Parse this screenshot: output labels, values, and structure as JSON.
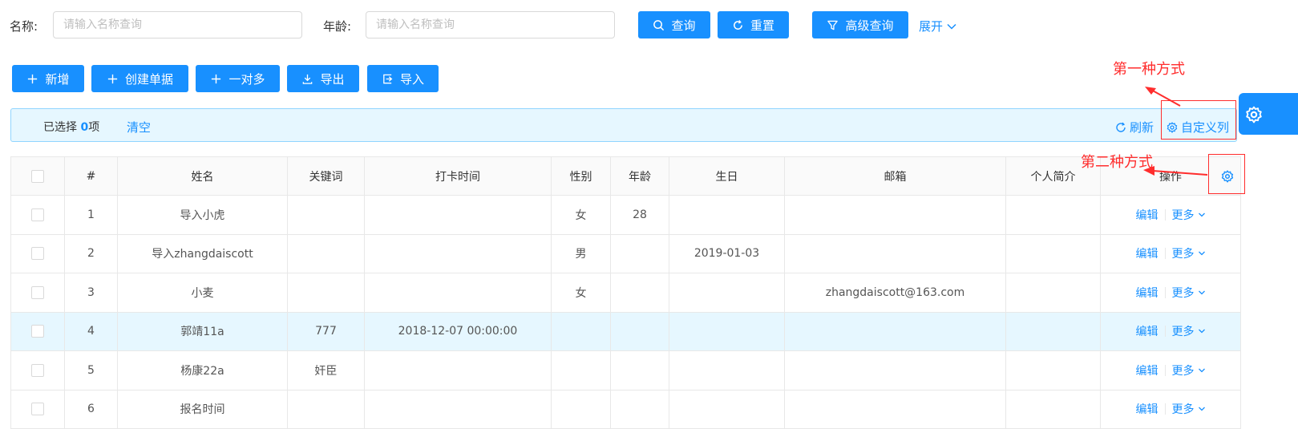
{
  "search": {
    "name_label": "名称:",
    "name_placeholder": "请输入名称查询",
    "age_label": "年龄:",
    "age_placeholder": "请输入名称查询",
    "query_label": "查询",
    "reset_label": "重置",
    "advanced_label": "高级查询",
    "expand_label": "展开"
  },
  "toolbar": {
    "add_label": "新增",
    "create_doc_label": "创建单据",
    "one_to_many_label": "一对多",
    "export_label": "导出",
    "import_label": "导入"
  },
  "alert": {
    "selected_prefix": "已选择 ",
    "selected_count": "0",
    "selected_suffix": "项",
    "clear_label": "清空",
    "refresh_label": "刷新",
    "custom_columns_label": "自定义列"
  },
  "annotations": {
    "first": "第一种方式",
    "second": "第二种方式"
  },
  "table": {
    "headers": [
      "#",
      "姓名",
      "关键词",
      "打卡时间",
      "性别",
      "年龄",
      "生日",
      "邮箱",
      "个人简介",
      "操作"
    ],
    "edit_label": "编辑",
    "more_label": "更多",
    "rows": [
      [
        "1",
        "导入小虎",
        "",
        "",
        "女",
        "28",
        "",
        "",
        ""
      ],
      [
        "2",
        "导入zhangdaiscott",
        "",
        "",
        "男",
        "",
        "2019-01-03",
        "",
        ""
      ],
      [
        "3",
        "小麦",
        "",
        "",
        "女",
        "",
        "",
        "zhangdaiscott@163.com",
        ""
      ],
      [
        "4",
        "郭靖11a",
        "777",
        "2018-12-07 00:00:00",
        "",
        "",
        "",
        "",
        ""
      ],
      [
        "5",
        "杨康22a",
        "奸臣",
        "",
        "",
        "",
        "",
        "",
        ""
      ],
      [
        "6",
        "报名时间",
        "",
        "",
        "",
        "",
        "",
        "",
        ""
      ]
    ]
  },
  "colors": {
    "primary": "#1890ff",
    "annotation": "#ff2d2d",
    "alert_bg": "#e6f7ff"
  }
}
